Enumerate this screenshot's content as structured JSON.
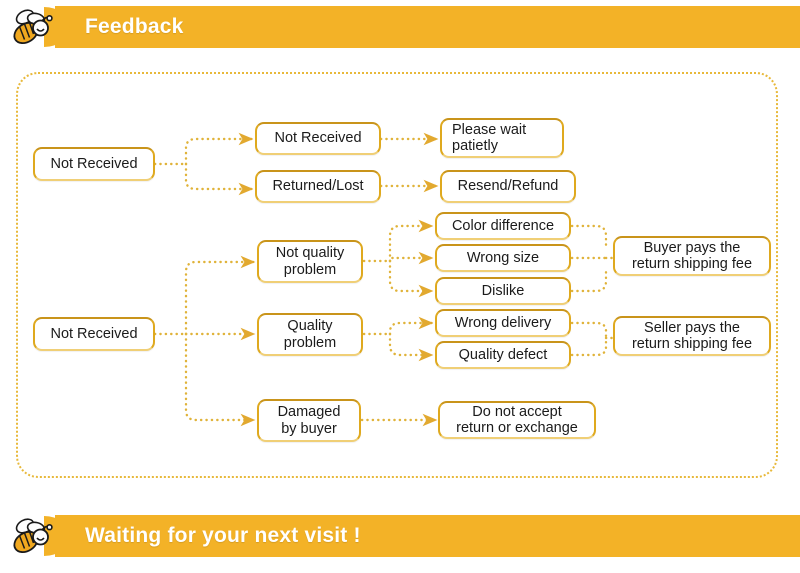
{
  "header": {
    "title": "Feedback",
    "icon": "bee-icon",
    "watermark": "",
    "bar_color": "#f3b227"
  },
  "footer": {
    "title": "Waiting for your next visit !",
    "icon": "bee-icon",
    "bar_color": "#f3b227"
  },
  "flow": {
    "border_color": "#e8b93b",
    "node_border_color": "#dfa91e",
    "connector_color": "#e0b33a",
    "nodes": [
      {
        "id": "not-received-root-1",
        "label": "Not Received"
      },
      {
        "id": "not-received-br",
        "label": "Not Received"
      },
      {
        "id": "returned-lost",
        "label": "Returned/Lost"
      },
      {
        "id": "please-wait",
        "label": "Please wait\npatietly"
      },
      {
        "id": "resend-refund",
        "label": "Resend/Refund"
      },
      {
        "id": "not-received-root-2",
        "label": "Not Received"
      },
      {
        "id": "not-quality-problem",
        "label": "Not quality\nproblem"
      },
      {
        "id": "quality-problem",
        "label": "Quality\nproblem"
      },
      {
        "id": "damaged-by-buyer",
        "label": "Damaged\nby buyer"
      },
      {
        "id": "color-difference",
        "label": "Color difference"
      },
      {
        "id": "wrong-size",
        "label": "Wrong size"
      },
      {
        "id": "dislike",
        "label": "Dislike"
      },
      {
        "id": "wrong-delivery",
        "label": "Wrong delivery"
      },
      {
        "id": "quality-defect",
        "label": "Quality defect"
      },
      {
        "id": "do-not-accept",
        "label": "Do not accept\nreturn or exchange"
      },
      {
        "id": "buyer-pays",
        "label": "Buyer pays the\nreturn shipping fee"
      },
      {
        "id": "seller-pays",
        "label": "Seller pays the\nreturn shipping fee"
      }
    ]
  }
}
